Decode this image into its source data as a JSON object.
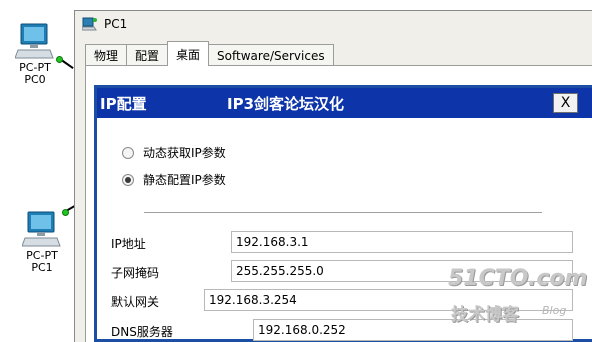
{
  "topology": {
    "devices": [
      {
        "type_label": "PC-PT",
        "name": "PC0"
      },
      {
        "type_label": "PC-PT",
        "name": "PC1"
      }
    ]
  },
  "window": {
    "icon": "packet-tracer-pc-icon",
    "title": "PC1",
    "tabs": [
      "物理",
      "配置",
      "桌面",
      "Software/Services"
    ],
    "active_tab": "桌面"
  },
  "dialog": {
    "title": "IP配置",
    "subtitle": "IP3剑客论坛汉化",
    "close_label": "X",
    "modes": [
      {
        "label": "动态获取IP参数",
        "selected": false
      },
      {
        "label": "静态配置IP参数",
        "selected": true
      }
    ],
    "fields": {
      "ip": {
        "label": "IP地址",
        "value": "192.168.3.1"
      },
      "mask": {
        "label": "子网掩码",
        "value": "255.255.255.0"
      },
      "gateway": {
        "label": "默认网关",
        "value": "192.168.3.254"
      },
      "dns": {
        "label": "DNS服务器",
        "value": "192.168.0.252"
      }
    }
  },
  "watermark": {
    "main": "51CTO.com",
    "sub": "技术博客",
    "blog": "Blog"
  },
  "colors": {
    "dialog_title_bg": "#0d34a8",
    "link_status_green": "#22c422"
  }
}
